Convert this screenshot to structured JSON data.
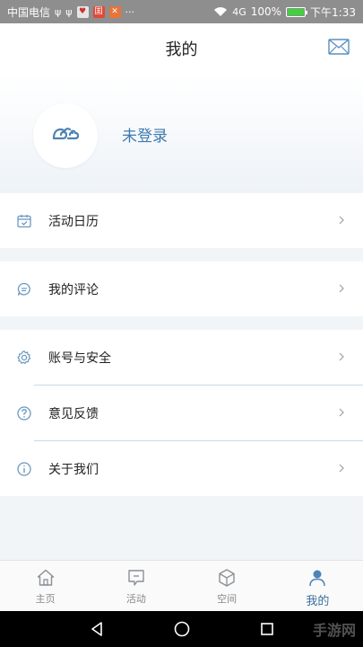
{
  "status_bar": {
    "carrier": "中国电信",
    "battery_pct": "100%",
    "time": "下午1:33",
    "signal_text": "4G"
  },
  "header": {
    "title": "我的",
    "login_status": "未登录"
  },
  "menu": {
    "group1": [
      {
        "label": "活动日历",
        "icon": "calendar-icon"
      }
    ],
    "group2": [
      {
        "label": "我的评论",
        "icon": "comment-icon"
      }
    ],
    "group3": [
      {
        "label": "账号与安全",
        "icon": "gear-icon"
      },
      {
        "label": "意见反馈",
        "icon": "question-icon"
      },
      {
        "label": "关于我们",
        "icon": "info-icon"
      }
    ]
  },
  "bottom_nav": [
    {
      "label": "主页",
      "icon": "home-icon",
      "active": false
    },
    {
      "label": "活动",
      "icon": "flag-icon",
      "active": false
    },
    {
      "label": "空间",
      "icon": "cube-icon",
      "active": false
    },
    {
      "label": "我的",
      "icon": "person-icon",
      "active": true
    }
  ],
  "watermark": "手游网",
  "colors": {
    "accent": "#3f7ab0",
    "icon": "#6c98bf",
    "status_bar": "#8e8e8e"
  }
}
